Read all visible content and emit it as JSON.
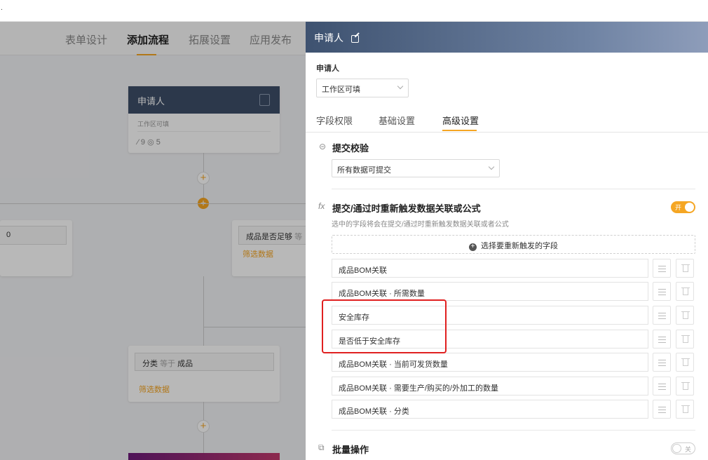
{
  "topbar": {
    "dot": "."
  },
  "steps": [
    "表单设计",
    "添加流程",
    "拓展设置",
    "应用发布"
  ],
  "flow": {
    "applicant_node": {
      "title": "申请人",
      "sub": "工作区可填",
      "counts": "⁄ 9  ◎ 5"
    },
    "left_cond_value": "0",
    "right_cond": {
      "label": "成品是否足够",
      "op": "等",
      "link": "筛选数据"
    },
    "mid_cond": {
      "field": "分类",
      "op": "等于",
      "value": "成品",
      "link": "筛选数据"
    }
  },
  "panel": {
    "title": "申请人",
    "applicant_label": "申请人",
    "applicant_select": "工作区可填",
    "tabs": [
      "字段权限",
      "基础设置",
      "高级设置"
    ],
    "submit_check": {
      "title": "提交校验",
      "select": "所有数据可提交"
    },
    "retrigger": {
      "title": "提交/通过时重新触发数据关联或公式",
      "toggle": "开",
      "desc": "选中的字段将会在提交/通过时重新触发数据关联或者公式",
      "add_label": "选择要重新触发的字段",
      "fields": [
        "成品BOM关联",
        "成品BOM关联 · 所需数量",
        "安全库存",
        "是否低于安全库存",
        "成品BOM关联 · 当前可发货数量",
        "成品BOM关联 · 需要生产/购买的/外加工的数量",
        "成品BOM关联 · 分类"
      ]
    },
    "batch": {
      "title": "批量操作",
      "toggle": "关"
    }
  },
  "colors": {
    "accent": "#f5a623",
    "header": "#3e5270",
    "highlight": "#e02020"
  }
}
